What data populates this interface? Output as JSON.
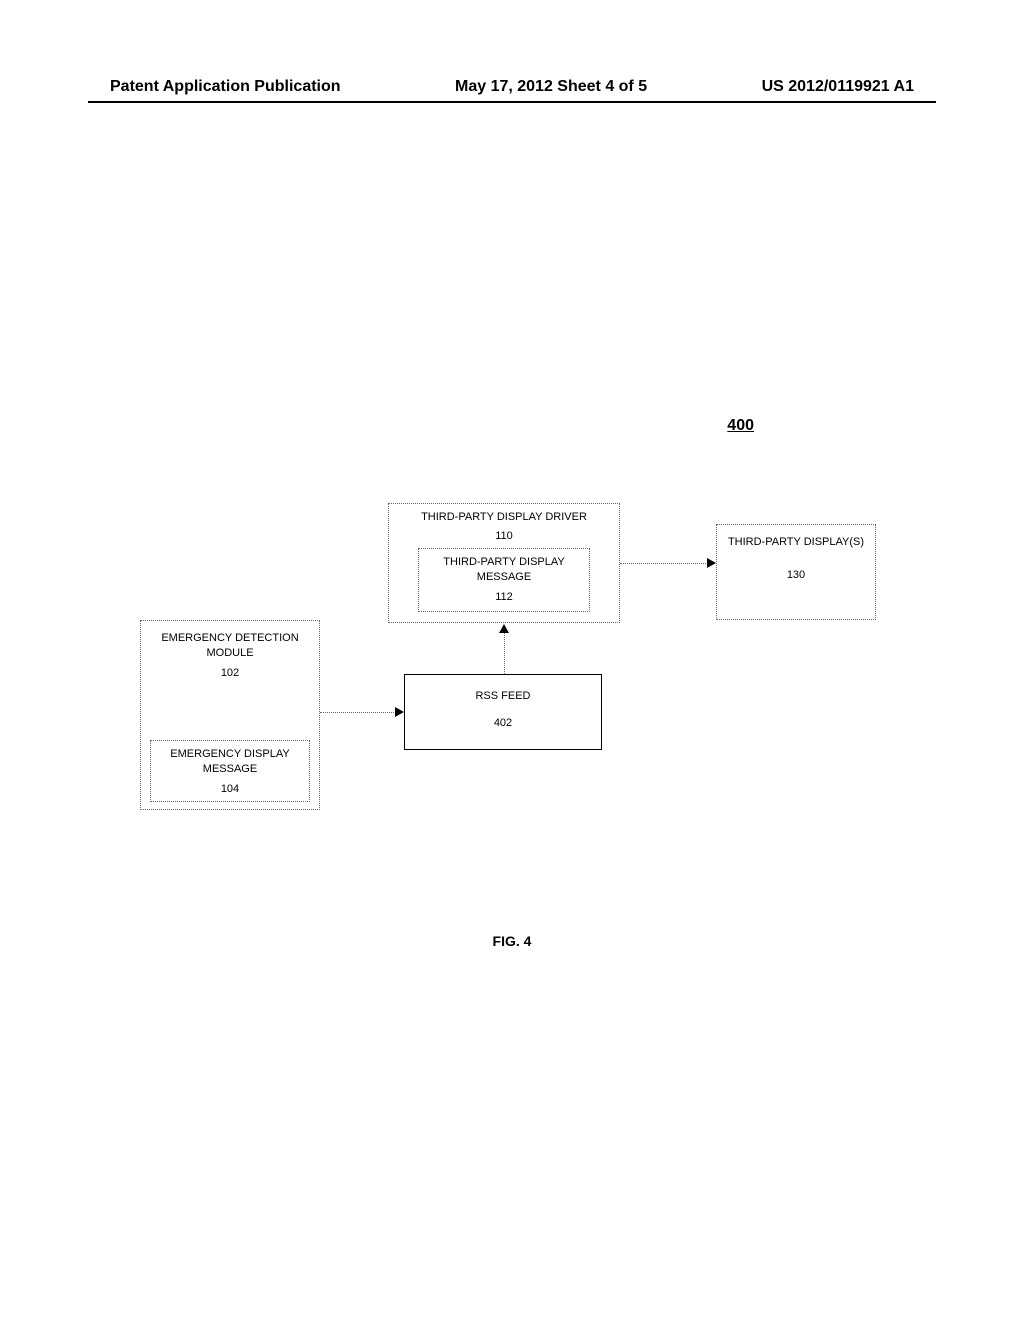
{
  "header": {
    "left": "Patent Application Publication",
    "center": "May 17, 2012  Sheet 4 of 5",
    "right": "US 2012/0119921 A1"
  },
  "figure_number": "400",
  "figure_caption": "FIG. 4",
  "blocks": {
    "edm": {
      "title": "EMERGENCY DETECTION MODULE",
      "num": "102"
    },
    "edm_msg": {
      "title": "EMERGENCY DISPLAY MESSAGE",
      "num": "104"
    },
    "tpdd": {
      "title": "THIRD-PARTY DISPLAY DRIVER",
      "num": "110"
    },
    "tpdd_msg": {
      "title": "THIRD-PARTY DISPLAY MESSAGE",
      "num": "112"
    },
    "rss": {
      "title": "RSS FEED",
      "num": "402"
    },
    "tpd": {
      "title": "THIRD-PARTY DISPLAY(S)",
      "num": "130"
    }
  }
}
